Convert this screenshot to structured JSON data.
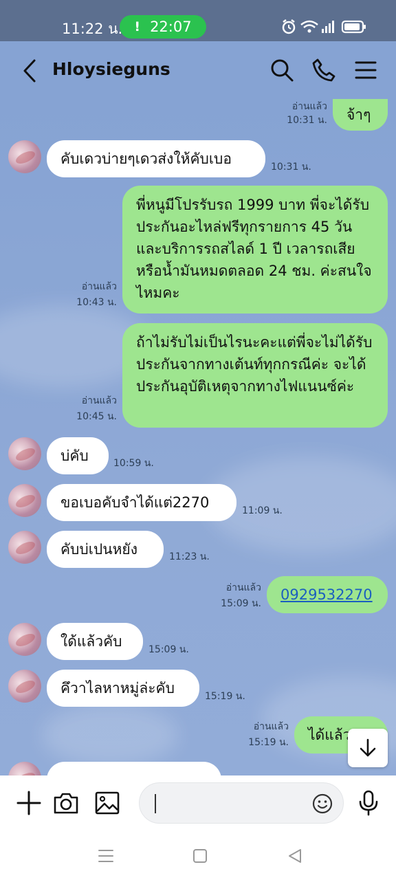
{
  "status_bar": {
    "time": "11:22 น.",
    "call_timer": "22:07",
    "call_indicator": "!",
    "icons": [
      "alarm-icon",
      "wifi-icon",
      "signal-icon",
      "battery-icon"
    ]
  },
  "header": {
    "contact_name": "Hloysieguns",
    "icons": [
      "back-icon",
      "search-icon",
      "phone-icon",
      "menu-icon"
    ]
  },
  "read_label": "อ่านแล้ว",
  "messages": [
    {
      "dir": "out",
      "text": "จ้าๆ",
      "time": "10:31 น.",
      "read": true
    },
    {
      "dir": "in",
      "text": "คับเดวบ่ายๆเดวส่งให้คับเบอ",
      "time": "10:31 น."
    },
    {
      "dir": "out",
      "text": "พี่หนูมีโปรรับรถ 1999 บาท พี่จะได้รับประกันอะไหล่ฟรีทุกรายการ 45 วัน และบริการรถสไลด์ 1 ปี เวลารถเสียหรือน้ำมันหมดตลอด 24 ชม. ค่ะสนใจไหมคะ",
      "time": "10:43 น.",
      "read": true
    },
    {
      "dir": "out",
      "text": "ถ้าไม่รับไม่เป็นไรนะคะแต่พี่จะไม่ได้รับประกันจากทางเต้นท์ทุกกรณีค่ะ จะได้ประกันอุบัติเหตุจากทางไฟแนนซ์ค่ะ",
      "time": "10:45 น.",
      "read": true
    },
    {
      "dir": "in",
      "text": "บ่คับ",
      "time": "10:59 น."
    },
    {
      "dir": "in",
      "text": "ขอเบอคับจำได้แต่2270",
      "time": "11:09 น."
    },
    {
      "dir": "in",
      "text": "คับบ่เปนหยัง",
      "time": "11:23 น."
    },
    {
      "dir": "out",
      "text": "0929532270",
      "time": "15:09 น.",
      "read": true,
      "link": true
    },
    {
      "dir": "in",
      "text": "ใด้แล้วคับ",
      "time": "15:09 น."
    },
    {
      "dir": "in",
      "text": "คึวาไลหาหมู่ล่ะคับ",
      "time": "15:19 น."
    },
    {
      "dir": "out",
      "text": "ได้แล้ว",
      "time": "15:19 น.",
      "read": true
    }
  ],
  "input_bar": {
    "placeholder": "",
    "icons": [
      "plus-icon",
      "camera-icon",
      "image-icon",
      "emoji-icon",
      "mic-icon"
    ]
  },
  "colors": {
    "chat_background": "#8aa6d6",
    "outgoing_bubble": "#9ee58f",
    "incoming_bubble": "#ffffff",
    "call_pill": "#2bc24f",
    "status_bar": "#5c6f8f",
    "link": "#1b5fbf"
  }
}
